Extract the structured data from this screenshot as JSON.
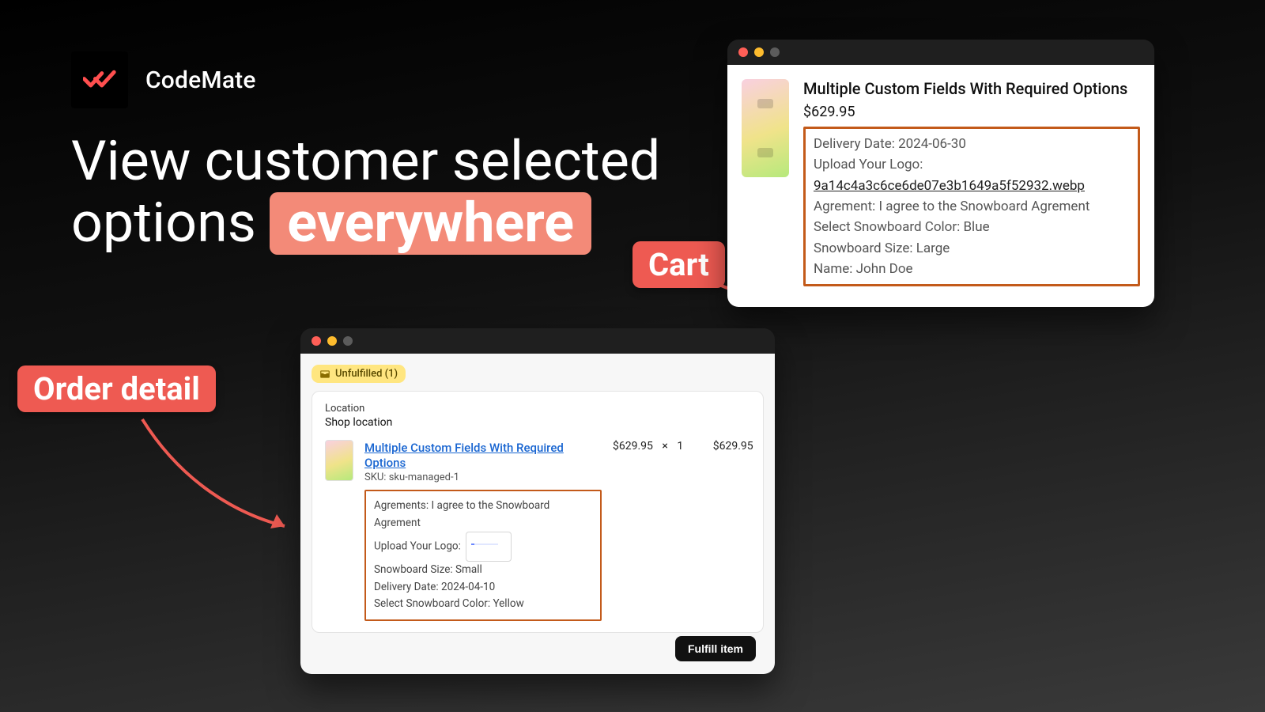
{
  "brand": {
    "name": "CodeMate"
  },
  "headline": {
    "line1": "View customer selected",
    "line2_pre": "options ",
    "chip": "everywhere"
  },
  "callouts": {
    "cart": "Cart",
    "order": "Order detail"
  },
  "cart": {
    "title": "Multiple Custom Fields With Required Options",
    "price": "$629.95",
    "options": {
      "delivery_label": "Delivery Date:",
      "delivery_value": "2024-06-30",
      "upload_label": "Upload Your Logo:",
      "upload_file": "9a14c4a3c6ce6de07e3b1649a5f52932.webp",
      "agreement_label": "Agrement:",
      "agreement_value": "I agree to the Snowboard Agrement",
      "color_label": "Select Snowboard Color:",
      "color_value": "Blue",
      "size_label": "Snowboard Size:",
      "size_value": "Large",
      "name_label": "Name:",
      "name_value": "John Doe"
    }
  },
  "order": {
    "pill": "Unfulfilled (1)",
    "location_label": "Location",
    "location_value": "Shop location",
    "item": {
      "title": "Multiple Custom Fields With Required Options",
      "sku_label": "SKU:",
      "sku_value": "sku-managed-1",
      "unit_price": "$629.95",
      "qty": "1",
      "total": "$629.95",
      "mul_sym": "×"
    },
    "options": {
      "agreement_label": "Agrements:",
      "agreement_value": "I agree to the Snowboard Agrement",
      "upload_label": "Upload Your Logo:",
      "size_label": "Snowboard Size:",
      "size_value": "Small",
      "delivery_label": "Delivery Date:",
      "delivery_value": "2024-04-10",
      "color_label": "Select Snowboard Color:",
      "color_value": "Yellow"
    },
    "fulfill_btn": "Fulfill item"
  }
}
